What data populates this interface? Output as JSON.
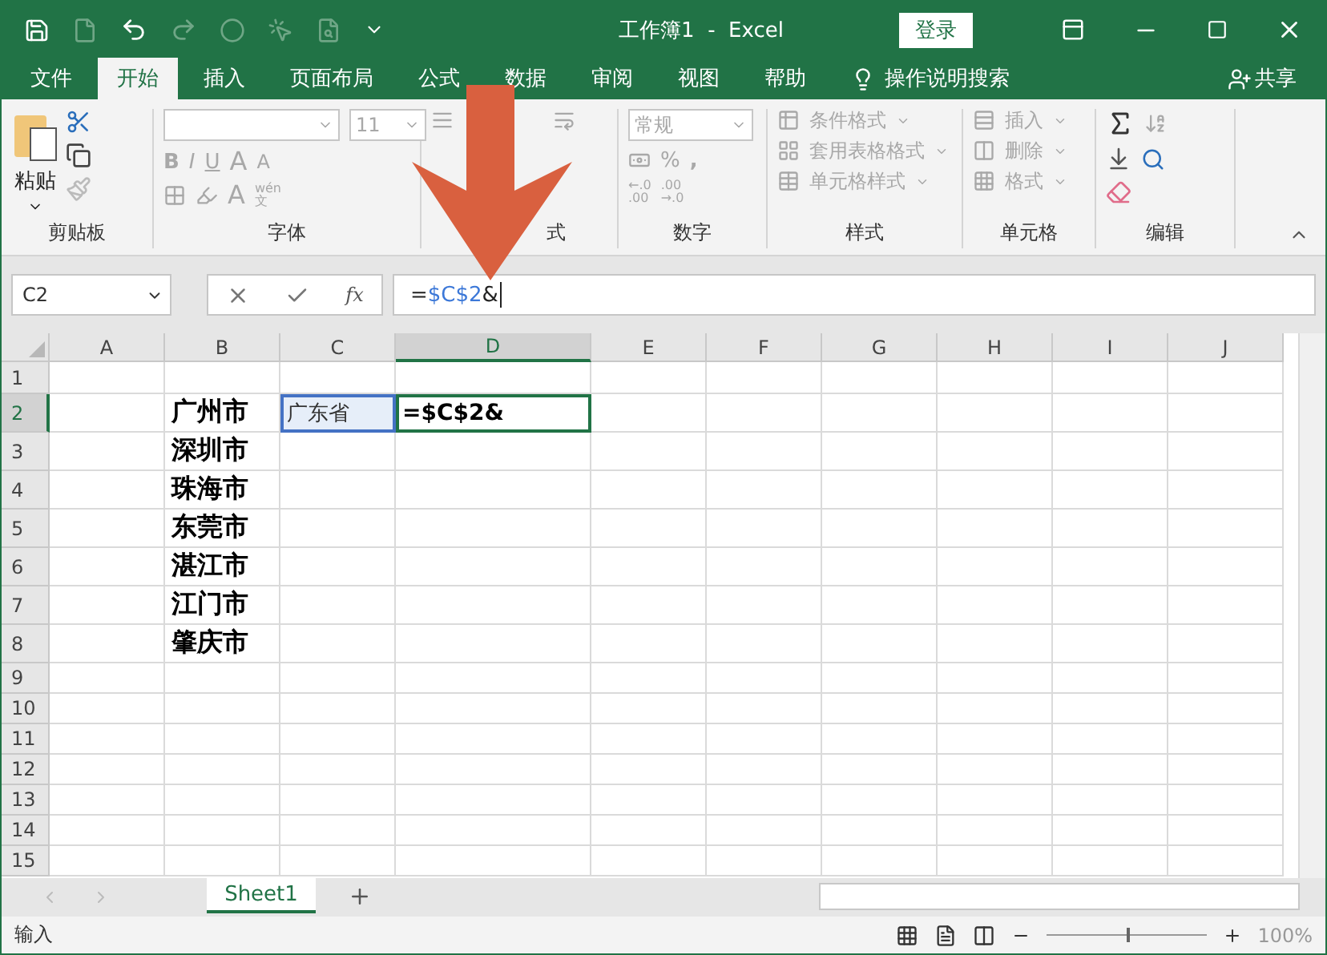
{
  "window": {
    "title": "工作簿1  -  Excel",
    "login_button": "登录",
    "quick_access": [
      {
        "kind": "save",
        "disabled": false
      },
      {
        "kind": "new",
        "disabled": true
      },
      {
        "kind": "undo",
        "disabled": false
      },
      {
        "kind": "redo",
        "disabled": true
      },
      {
        "kind": "circle",
        "disabled": true
      },
      {
        "kind": "touch",
        "disabled": true
      },
      {
        "kind": "preview",
        "disabled": true
      },
      {
        "kind": "customize",
        "disabled": false
      }
    ]
  },
  "tabs": [
    {
      "label": "文件",
      "selected": false
    },
    {
      "label": "开始",
      "selected": true
    },
    {
      "label": "插入",
      "selected": false
    },
    {
      "label": "页面布局",
      "selected": false
    },
    {
      "label": "公式",
      "selected": false
    },
    {
      "label": "数据",
      "selected": false
    },
    {
      "label": "审阅",
      "selected": false
    },
    {
      "label": "视图",
      "selected": false
    },
    {
      "label": "帮助",
      "selected": false
    }
  ],
  "tell_me": "操作说明搜索",
  "share": "共享",
  "ribbon": {
    "groups": [
      {
        "kind": "clipboard",
        "label": "剪贴板",
        "disabled": false,
        "paste": "粘贴"
      },
      {
        "kind": "font",
        "label": "字体",
        "disabled": true,
        "font_size": "11",
        "bold": "B",
        "italic": "I",
        "underline": "U",
        "grow": "A",
        "shrink": "A",
        "font_color": "A",
        "phonetic_top": "wén",
        "phonetic_bottom": "文"
      },
      {
        "kind": "alignment",
        "label": "式",
        "disabled": true
      },
      {
        "kind": "number",
        "label": "数字",
        "disabled": true,
        "format": "常规",
        "percent": "%",
        "comma": ",",
        "decimals": [
          {
            "top": "←.0",
            "bottom": ".00"
          },
          {
            "top": ".00",
            "bottom": "→.0"
          }
        ]
      },
      {
        "kind": "styles",
        "label": "样式",
        "disabled": true,
        "items": [
          "条件格式",
          "套用表格格式",
          "单元格样式"
        ]
      },
      {
        "kind": "cells",
        "label": "单元格",
        "disabled": true,
        "items": [
          "插入",
          "删除",
          "格式"
        ]
      },
      {
        "kind": "editing",
        "label": "编辑",
        "disabled": false
      }
    ]
  },
  "formula_bar": {
    "name_box": "C2",
    "function_button": "fx",
    "formula": [
      {
        "text": "=",
        "reference": false
      },
      {
        "text": "$C$2",
        "reference": true
      },
      {
        "text": "&",
        "reference": false
      }
    ]
  },
  "sheet": {
    "columns": [
      {
        "label": "A",
        "selected": false
      },
      {
        "label": "B",
        "selected": false
      },
      {
        "label": "C",
        "selected": false
      },
      {
        "label": "D",
        "selected": true
      },
      {
        "label": "E",
        "selected": false
      },
      {
        "label": "F",
        "selected": false
      },
      {
        "label": "G",
        "selected": false
      },
      {
        "label": "H",
        "selected": false
      },
      {
        "label": "I",
        "selected": false
      },
      {
        "label": "J",
        "selected": false
      }
    ],
    "rows": [
      {
        "label": "1",
        "selected": false
      },
      {
        "label": "2",
        "selected": true,
        "column_b": {
          "text": "广州市"
        },
        "column_c": {
          "text": "广东省",
          "referenced": true
        },
        "column_d": {
          "text": "=$C$2&",
          "editing": true
        }
      },
      {
        "label": "3",
        "selected": false,
        "column_b": {
          "text": "深圳市"
        }
      },
      {
        "label": "4",
        "selected": false,
        "column_b": {
          "text": "珠海市"
        }
      },
      {
        "label": "5",
        "selected": false,
        "column_b": {
          "text": "东莞市"
        }
      },
      {
        "label": "6",
        "selected": false,
        "column_b": {
          "text": "湛江市"
        }
      },
      {
        "label": "7",
        "selected": false,
        "column_b": {
          "text": "江门市"
        }
      },
      {
        "label": "8",
        "selected": false,
        "column_b": {
          "text": "肇庆市"
        }
      },
      {
        "label": "9",
        "selected": false
      },
      {
        "label": "10",
        "selected": false
      },
      {
        "label": "11",
        "selected": false
      },
      {
        "label": "12",
        "selected": false
      },
      {
        "label": "13",
        "selected": false
      },
      {
        "label": "14",
        "selected": false
      },
      {
        "label": "15",
        "selected": false
      }
    ]
  },
  "sheet_tabs": [
    {
      "label": "Sheet1",
      "selected": true
    }
  ],
  "status_bar": {
    "mode": "输入",
    "zoom": "100%",
    "level": 0.5
  }
}
